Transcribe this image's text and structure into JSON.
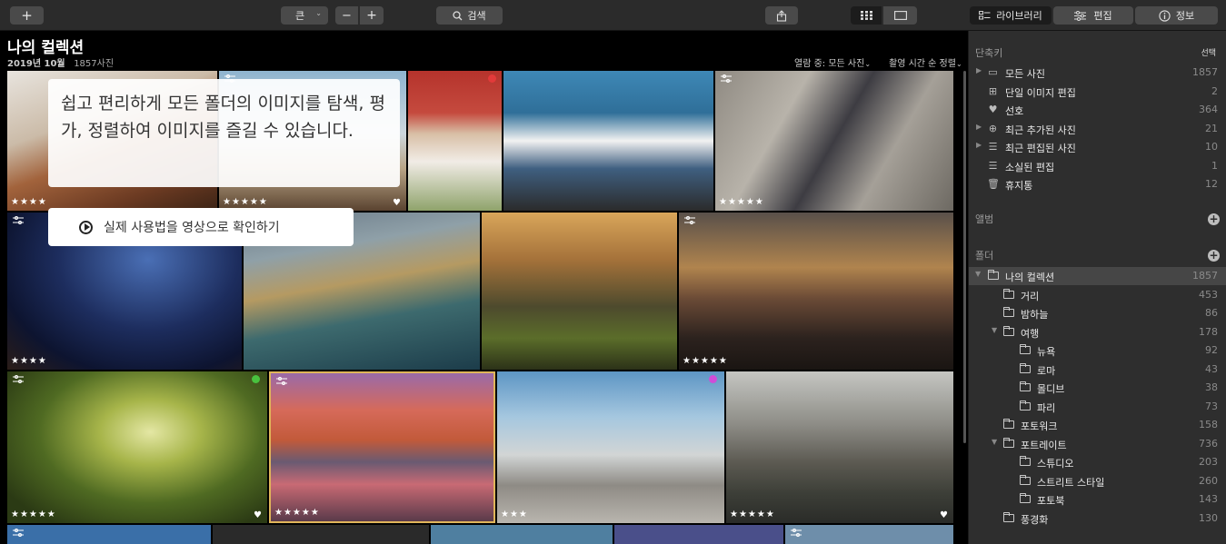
{
  "toolbar": {
    "add": "+",
    "size": "큰",
    "zoom_out": "−",
    "zoom_in": "+",
    "search": "검색",
    "tabs": [
      "라이브러리",
      "편집",
      "정보"
    ]
  },
  "header": {
    "title": "나의 컬렉션",
    "date": "2019년 10월",
    "count": "1857사진",
    "view_label": "열람 중: 모든 사진",
    "sort_label": "촬영 시간 순 정렬"
  },
  "overlay": {
    "text": "쉽고 편리하게 모든 폴더의 이미지를 탐색, 평가, 정렬하여 이미지를 즐길 수 있습니다.",
    "video_button": "실제 사용법을 영상으로 확인하기"
  },
  "photos": [
    {
      "stars": "★★★★",
      "heart": false
    },
    {
      "stars": "★★★★★",
      "heart": true
    },
    {
      "stars": "",
      "heart": false
    },
    {
      "stars": "",
      "heart": false
    },
    {
      "stars": "★★★★★",
      "heart": false
    },
    {
      "stars": "★★★★",
      "heart": false
    },
    {
      "stars": "",
      "heart": false
    },
    {
      "stars": "",
      "heart": false
    },
    {
      "stars": "★★★★★",
      "heart": false
    },
    {
      "stars": "★★★★★",
      "heart": true
    },
    {
      "stars": "★★★★★",
      "heart": false
    },
    {
      "stars": "★★★",
      "heart": false
    },
    {
      "stars": "★★★★★",
      "heart": true
    }
  ],
  "sidebar": {
    "shortcuts_title": "단축키",
    "select": "선택",
    "shortcuts": [
      {
        "label": "모든 사진",
        "count": "1857",
        "icon": "stack-icon"
      },
      {
        "label": "단일 이미지 편집",
        "count": "2",
        "icon": "grid-icon"
      },
      {
        "label": "선호",
        "count": "364",
        "icon": "heart-icon"
      },
      {
        "label": "최근 추가된 사진",
        "count": "21",
        "icon": "add-circle-icon"
      },
      {
        "label": "최근 편집된 사진",
        "count": "10",
        "icon": "sliders-icon"
      },
      {
        "label": "소실된 편집",
        "count": "1",
        "icon": "sliders-icon"
      },
      {
        "label": "휴지통",
        "count": "12",
        "icon": "trash-icon"
      }
    ],
    "albums_title": "앨범",
    "folders_title": "폴더",
    "folders": [
      {
        "label": "나의 컬렉션",
        "count": "1857"
      },
      {
        "label": "거리",
        "count": "453"
      },
      {
        "label": "밤하늘",
        "count": "86"
      },
      {
        "label": "여행",
        "count": "178"
      },
      {
        "label": "뉴욕",
        "count": "92"
      },
      {
        "label": "로마",
        "count": "43"
      },
      {
        "label": "몰디브",
        "count": "38"
      },
      {
        "label": "파리",
        "count": "73"
      },
      {
        "label": "포토워크",
        "count": "158"
      },
      {
        "label": "포트레이트",
        "count": "736"
      },
      {
        "label": "스튜디오",
        "count": "203"
      },
      {
        "label": "스트리트 스타일",
        "count": "260"
      },
      {
        "label": "포토북",
        "count": "143"
      },
      {
        "label": "풍경화",
        "count": "130"
      }
    ]
  }
}
